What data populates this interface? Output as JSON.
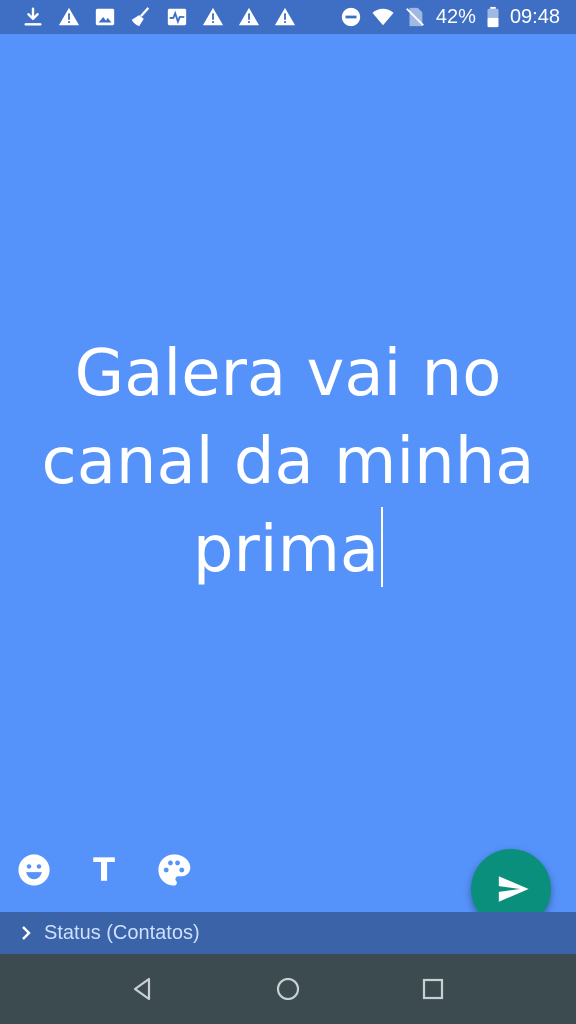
{
  "status_bar": {
    "battery_percent": "42%",
    "time": "09:48",
    "left_icons": [
      "download-icon",
      "warning-icon",
      "image-icon",
      "broom-icon",
      "pulse-icon",
      "warning-icon",
      "warning-icon",
      "warning-icon"
    ],
    "right_icons": [
      "do-not-disturb-icon",
      "wifi-icon",
      "no-sim-icon",
      "battery-icon"
    ]
  },
  "composer": {
    "text_lines": [
      "Galera vai no",
      "canal da minha",
      "prima"
    ],
    "background_color": "#5593fb"
  },
  "tools": {
    "text_tool_label": "T",
    "icons": [
      "emoji-icon",
      "text-tool-icon",
      "palette-icon"
    ]
  },
  "recipient": {
    "label": "Status (Contatos)"
  },
  "send_button": {
    "color": "#0b8f7d",
    "icon": "send-icon"
  },
  "nav_bar": {
    "icons": [
      "back-icon",
      "home-icon",
      "recents-icon"
    ]
  }
}
